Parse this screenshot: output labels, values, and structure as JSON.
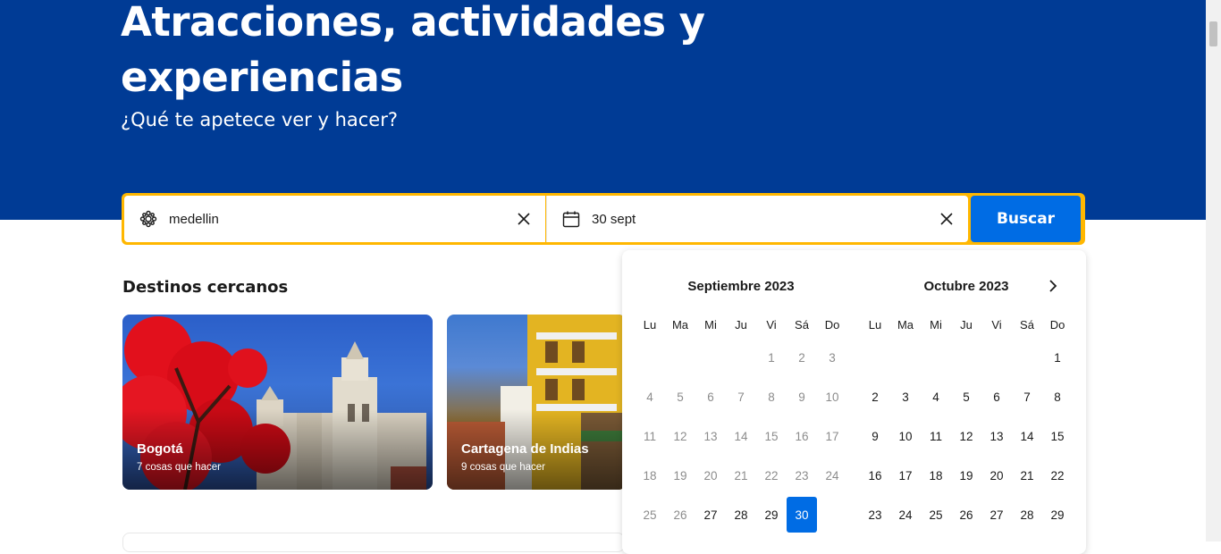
{
  "hero": {
    "title": "Atracciones, actividades y experiencias",
    "subtitle": "¿Qué te apetece ver y hacer?",
    "background": "#003b95"
  },
  "search": {
    "destination_value": "medellin",
    "destination_icon": "attraction-icon",
    "date_value": "30 sept",
    "date_icon": "calendar-icon",
    "button_label": "Buscar",
    "border_color": "#ffb700",
    "button_color": "#006ce4"
  },
  "nearby": {
    "title": "Destinos cercanos",
    "cards": [
      {
        "name": "Bogotá",
        "count": "7 cosas que hacer"
      },
      {
        "name": "Cartagena de Indias",
        "count": "9 cosas que hacer"
      }
    ]
  },
  "calendar": {
    "weekdays": [
      "Lu",
      "Ma",
      "Mi",
      "Ju",
      "Vi",
      "Sá",
      "Do"
    ],
    "months": [
      {
        "title": "Septiembre 2023",
        "offset": 4,
        "days": 30,
        "past_until": 26,
        "selected": 30
      },
      {
        "title": "Octubre 2023",
        "offset": 6,
        "days": 29,
        "past_until": 0,
        "selected": 0
      }
    ],
    "selected_color": "#006ce4"
  }
}
